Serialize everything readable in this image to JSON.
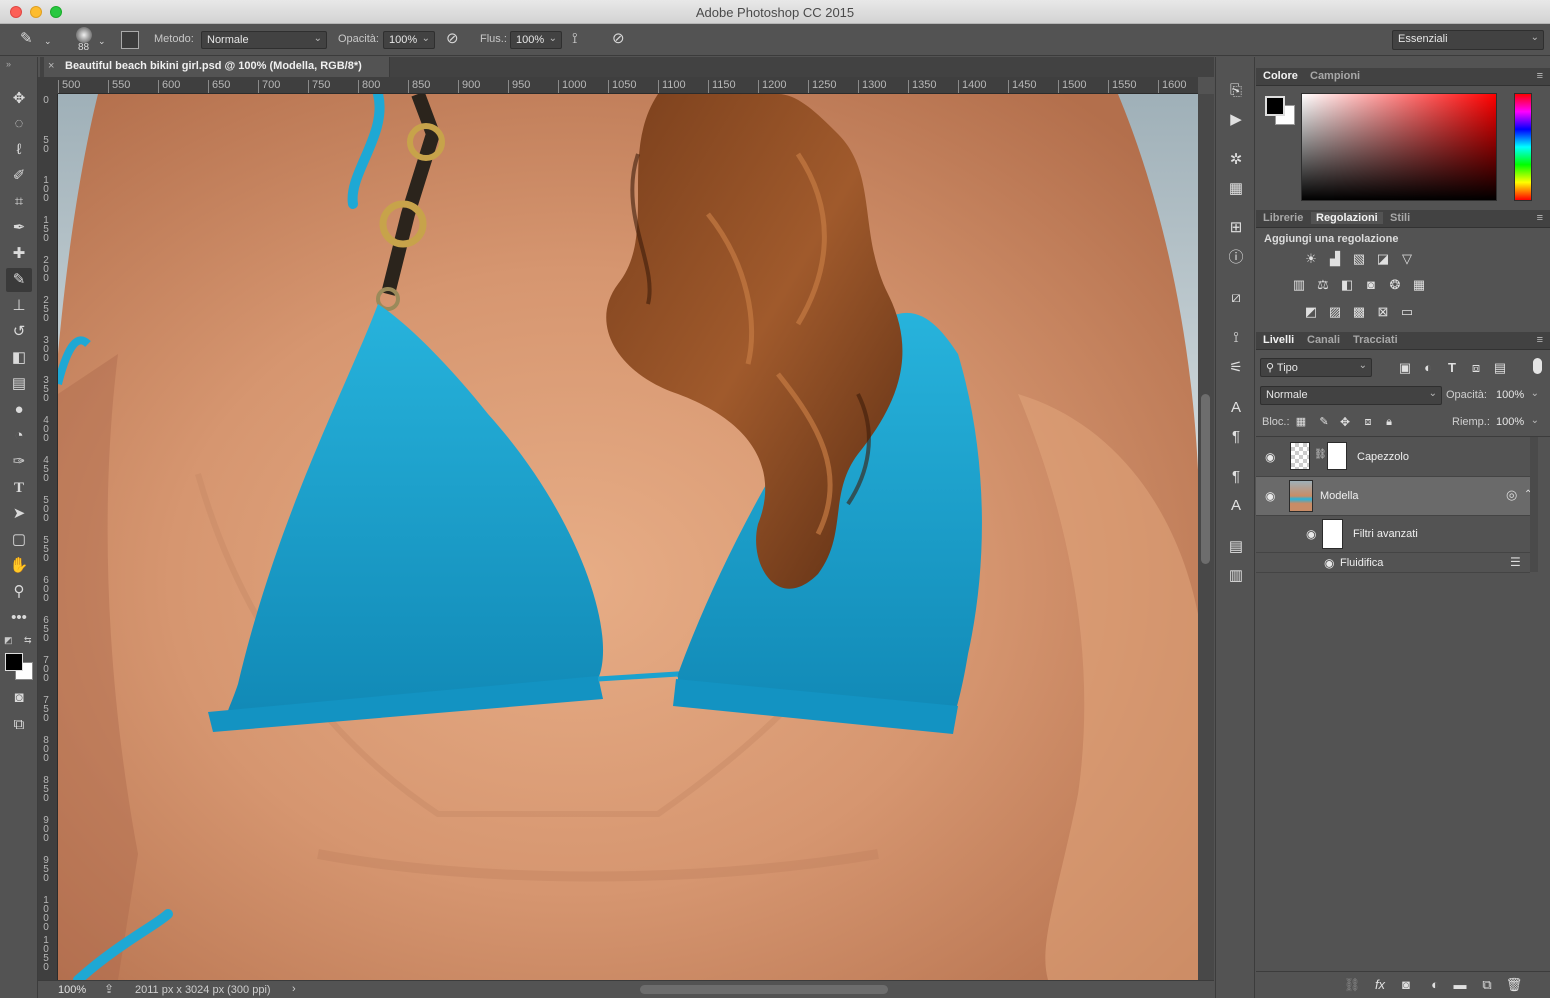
{
  "window": {
    "title": "Adobe Photoshop CC 2015"
  },
  "options": {
    "brush_size": "88",
    "method_label": "Metodo:",
    "method_value": "Normale",
    "opacity_label": "Opacità:",
    "opacity_value": "100%",
    "flow_label": "Flus.:",
    "flow_value": "100%",
    "workspace": "Essenziali"
  },
  "document": {
    "tab_title": "Beautiful beach bikini girl.psd @ 100% (Modella, RGB/8*)",
    "close_glyph": "×"
  },
  "rulers": {
    "horizontal": [
      "500",
      "550",
      "600",
      "650",
      "700",
      "750",
      "800",
      "850",
      "900",
      "950",
      "1000",
      "1050",
      "1100",
      "1150",
      "1200",
      "1250",
      "1300",
      "1350",
      "1400",
      "1450",
      "1500",
      "1550",
      "1600"
    ],
    "vertical": [
      "0",
      "50",
      "100",
      "150",
      "200",
      "250",
      "300",
      "350",
      "400",
      "450",
      "500",
      "550",
      "600",
      "650",
      "700",
      "750",
      "800",
      "850",
      "900",
      "950",
      "1000",
      "1050"
    ]
  },
  "status": {
    "zoom": "100%",
    "doc_info": "2011 px x 3024 px (300 ppi)"
  },
  "color_panel": {
    "tabs": [
      "Colore",
      "Campioni"
    ],
    "foreground": "#000000",
    "background": "#ffffff",
    "hue": "#ff0000"
  },
  "adjust_panel": {
    "tabs": [
      "Librerie",
      "Regolazioni",
      "Stili"
    ],
    "heading": "Aggiungi una regolazione"
  },
  "layers_panel": {
    "tabs": [
      "Livelli",
      "Canali",
      "Tracciati"
    ],
    "filter_kind": "Tipo",
    "blend_mode": "Normale",
    "opacity_label": "Opacità:",
    "opacity_value": "100%",
    "lock_label": "Bloc.:",
    "fill_label": "Riemp.:",
    "fill_value": "100%",
    "layers": [
      {
        "name": "Capezzolo"
      },
      {
        "name": "Modella"
      },
      {
        "name": "Filtri avanzati"
      },
      {
        "name": "Fluidifica"
      }
    ]
  },
  "icons": {
    "tools": [
      "move-icon",
      "marquee-icon",
      "lasso-icon",
      "quick-select-icon",
      "crop-icon",
      "eyedropper-icon",
      "healing-icon",
      "brush-icon",
      "stamp-icon",
      "history-brush-icon",
      "eraser-icon",
      "gradient-icon",
      "blur-icon",
      "dodge-icon",
      "pen-icon",
      "type-icon",
      "path-select-icon",
      "shape-icon",
      "hand-icon",
      "zoom-icon",
      "more-icon"
    ]
  }
}
